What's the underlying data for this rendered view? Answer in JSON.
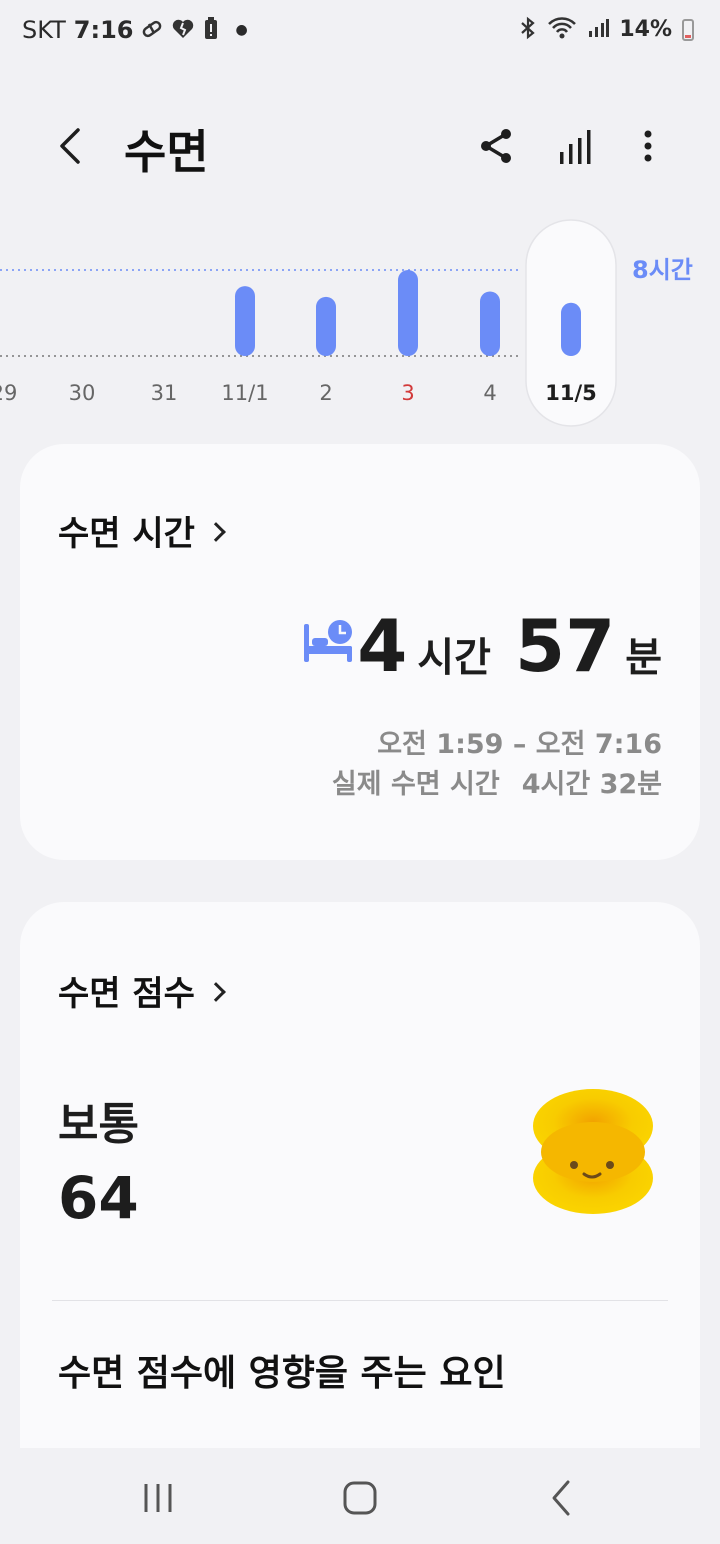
{
  "status_bar": {
    "carrier": "SKT",
    "time": "7:16",
    "battery": "14%"
  },
  "header": {
    "title": "수면",
    "icons": [
      "back-icon",
      "share-icon",
      "bar-chart-icon",
      "more-vert-icon"
    ]
  },
  "sleep_chart": {
    "goal_label": "8시간",
    "days": [
      {
        "label": "29",
        "hours": null,
        "holiday": false
      },
      {
        "label": "30",
        "hours": null,
        "holiday": false
      },
      {
        "label": "31",
        "hours": null,
        "holiday": false
      },
      {
        "label": "11/1",
        "hours": 6.5,
        "holiday": false
      },
      {
        "label": "2",
        "hours": 5.5,
        "holiday": false
      },
      {
        "label": "3",
        "hours": 8.0,
        "holiday": true
      },
      {
        "label": "4",
        "hours": 6.0,
        "holiday": false
      },
      {
        "label": "11/5",
        "hours": 4.95,
        "holiday": false,
        "selected": true
      }
    ],
    "colors": {
      "bar": "#6b8cf7",
      "goal_label": "#6b8cf7",
      "holiday": "#d23a3a"
    }
  },
  "sleep_time_card": {
    "title": "수면 시간",
    "hours_value": "4",
    "hours_unit": "시간",
    "minutes_value": "57",
    "minutes_unit": "분",
    "time_range": "오전 1:59 – 오전 7:16",
    "actual_label": "실제 수면 시간",
    "actual_value": "4시간 32분"
  },
  "sleep_score_card": {
    "title": "수면 점수",
    "grade": "보통",
    "score": "64",
    "factors_title": "수면 점수에 영향을 주는 요인",
    "face_color": "#f7cf00"
  }
}
